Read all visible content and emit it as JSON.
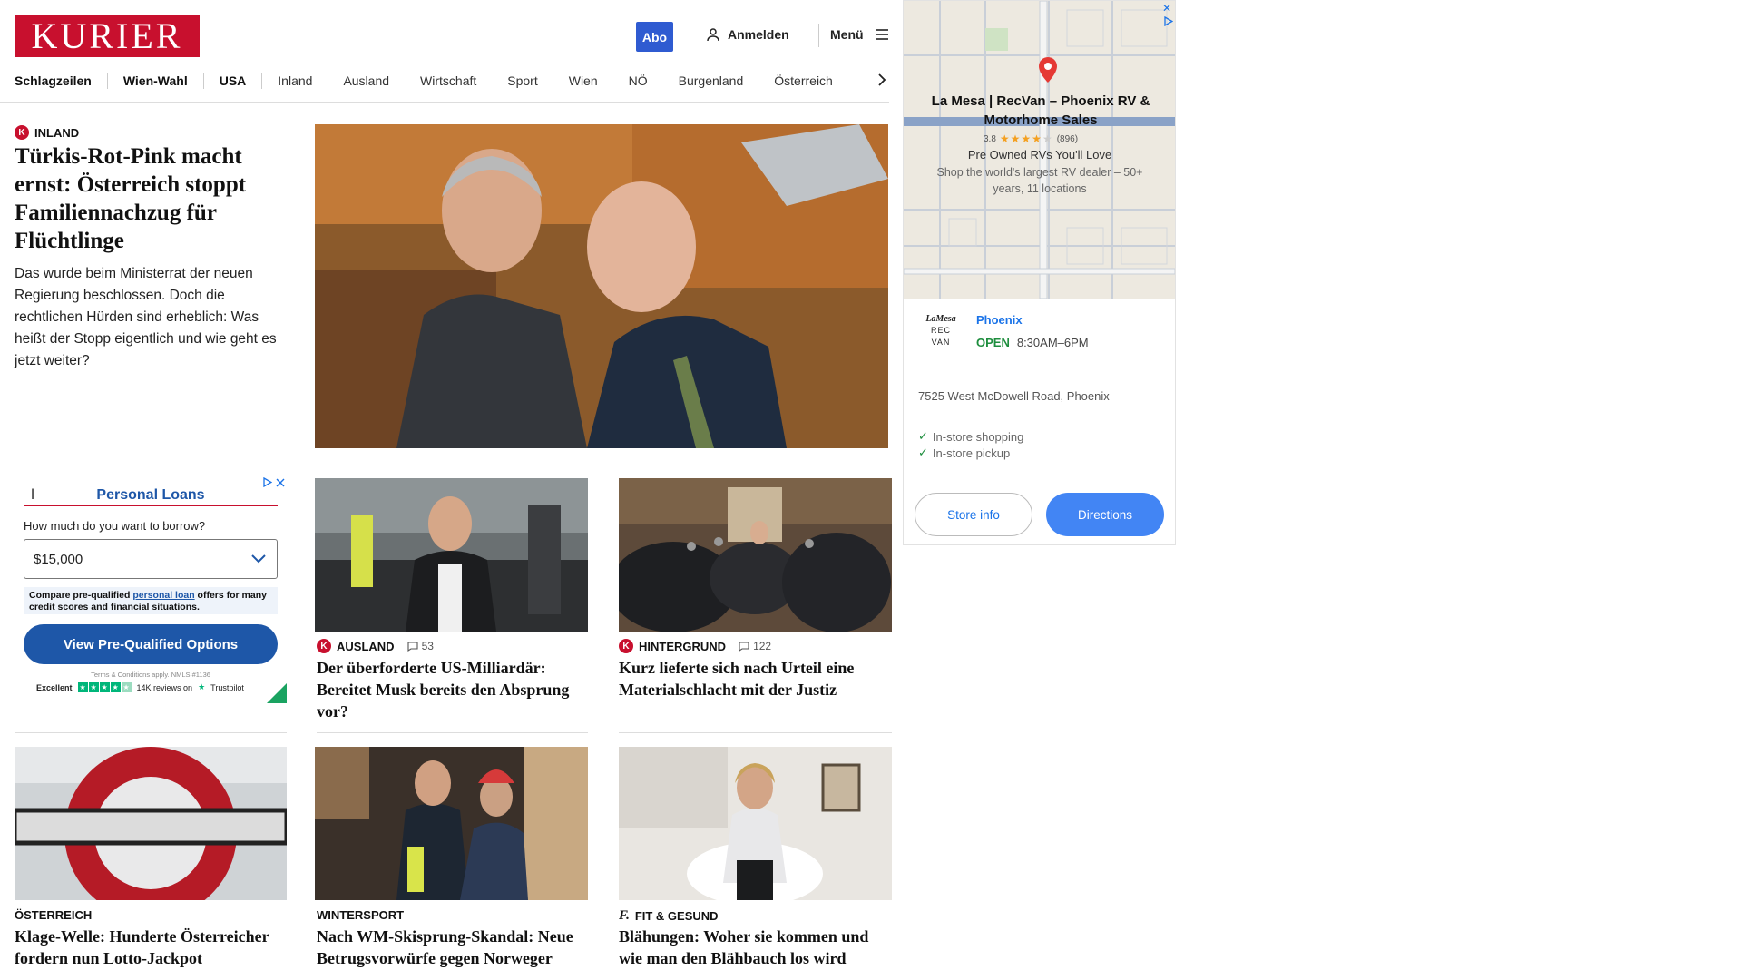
{
  "header": {
    "logo": "KURIER",
    "abo": "Abo",
    "login": "Anmelden",
    "menu": "Menü"
  },
  "nav": [
    "Schlagzeilen",
    "Wien-Wahl",
    "USA",
    "Inland",
    "Ausland",
    "Wirtschaft",
    "Sport",
    "Wien",
    "NÖ",
    "Burgenland",
    "Österreich"
  ],
  "lead": {
    "kicker": "INLAND",
    "title": "Türkis-Rot-Pink macht ernst: Österreich stoppt Familiennachzug für Flüchtlinge",
    "teaser": "Das wurde beim Ministerrat der neuen Regierung beschlossen. Doch die rechtlichen Hürden sind erheblich: Was heißt der Stopp eigentlich und wie geht es jetzt weiter?"
  },
  "cards": [
    {
      "kicker": "AUSLAND",
      "comments": "53",
      "title": "Der überforderte US-Milliardär: Bereitet Musk bereits den Absprung vor?"
    },
    {
      "kicker": "HINTERGRUND",
      "comments": "122",
      "title": "Kurz lieferte sich nach Urteil eine Materialschlacht mit der Justiz"
    },
    {
      "kicker": "ÖSTERREICH",
      "title": "Klage-Welle: Hunderte Österreicher fordern nun Lotto-Jackpot"
    },
    {
      "kicker": "WINTERSPORT",
      "title": "Nach WM-Skisprung-Skandal: Neue Betrugsvorwürfe gegen Norweger"
    },
    {
      "kicker": "FIT & GESUND",
      "title": "Blähungen: Woher sie kommen und wie man den Blähbauch los wird"
    }
  ],
  "loan_ad": {
    "letter": "l",
    "title": "Personal Loans",
    "question": "How much do you want to borrow?",
    "amount": "$15,000",
    "note_pre": "Compare pre-qualified ",
    "note_link": "personal loan",
    "note_post": " offers for many credit scores and financial situations.",
    "button": "View Pre-Qualified Options",
    "terms": "Terms & Conditions apply. NMLS #1136",
    "trust_label": "Excellent",
    "trust_reviews": "14K reviews on",
    "trust_brand": "Trustpilot"
  },
  "map_ad": {
    "name": "La Mesa | RecVan – Phoenix RV & Motorhome Sales",
    "rating": "3.8",
    "reviews": "(896)",
    "tagline": "Pre Owned RVs You'll Love",
    "description": "Shop the world's largest RV dealer – 50+ years, 11 locations",
    "logo_top": "LaMesa",
    "logo_bottom": "REC VAN",
    "city": "Phoenix",
    "open": "OPEN",
    "hours": "8:30AM–6PM",
    "address": "7525 West McDowell Road, Phoenix",
    "features": [
      "In-store shopping",
      "In-store pickup"
    ],
    "store_info": "Store info",
    "directions": "Directions"
  },
  "colors": {
    "brand": "#c8102e",
    "abo": "#2f5bd1",
    "loan_blue": "#1e57a8",
    "map_blue": "#4285f4",
    "open_green": "#1e8e3e"
  }
}
